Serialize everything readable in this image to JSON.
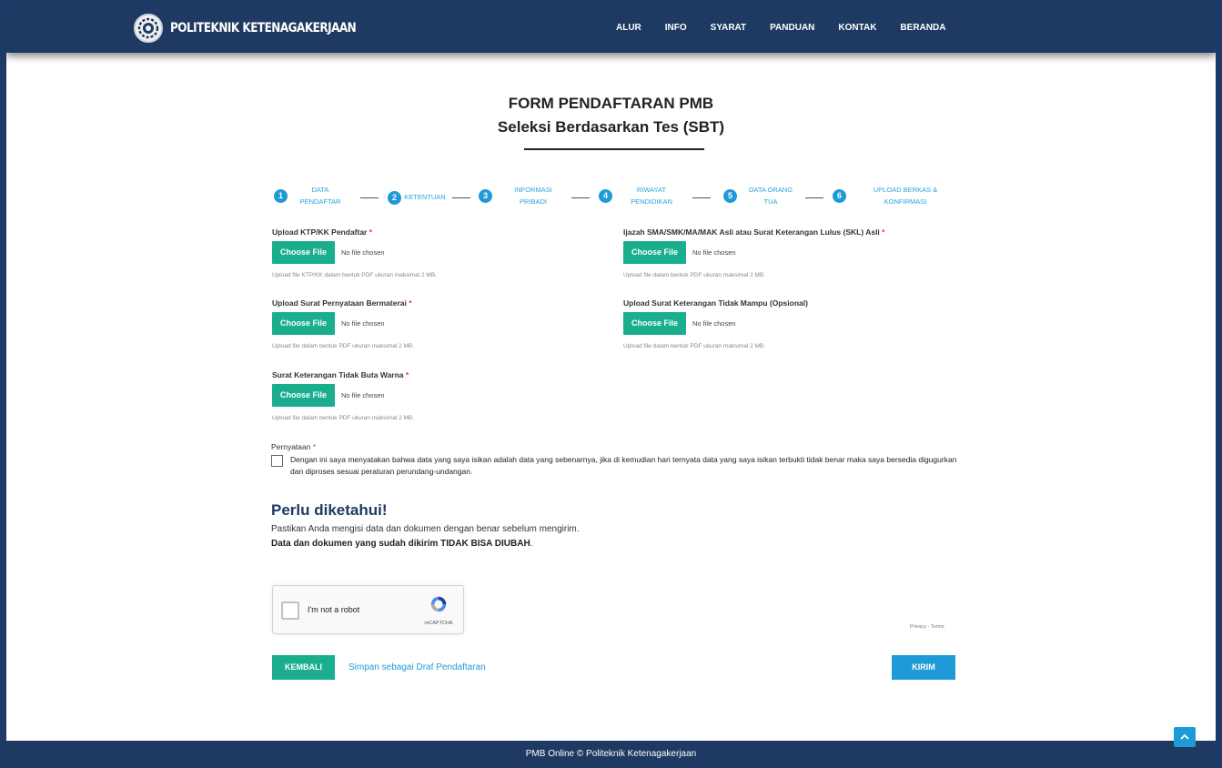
{
  "brand": {
    "name": "POLITEKNIK KETENAGAKERJAAN"
  },
  "nav": [
    "ALUR",
    "INFO",
    "SYARAT",
    "PANDUAN",
    "KONTAK",
    "BERANDA"
  ],
  "form": {
    "title": "FORM PENDAFTARAN PMB",
    "subtitle": "Seleksi Berdasarkan Tes (SBT)"
  },
  "steps": [
    {
      "num": "1",
      "line1": "DATA",
      "line2": "PENDAFTAR"
    },
    {
      "num": "2",
      "line1": "KETENTUAN",
      "line2": ""
    },
    {
      "num": "3",
      "line1": "INFORMASI",
      "line2": "PRIBADI"
    },
    {
      "num": "4",
      "line1": "RIWAYAT",
      "line2": "PENDIDIKAN"
    },
    {
      "num": "5",
      "line1": "DATA ORANG",
      "line2": "TUA"
    },
    {
      "num": "6",
      "line1": "UPLOAD BERKAS &",
      "line2": "KONFIRMASI"
    }
  ],
  "uploads": [
    {
      "label": "Upload KTP/KK Pendaftar",
      "required": "*",
      "button": "Choose File",
      "status": "No file chosen",
      "help": "Upload file KTP/KK dalam bentuk PDF ukuran maksimal 2 MB."
    },
    {
      "label": "Ijazah SMA/SMK/MA/MAK Asli atau Surat Keterangan Lulus (SKL) Asli",
      "required": "*",
      "button": "Choose File",
      "status": "No file chosen",
      "help": "Upload file dalam bentuk PDF ukuran maksimal 2 MB."
    },
    {
      "label": "Upload Surat Pernyataan Bermaterai",
      "required": "*",
      "button": "Choose File",
      "status": "No file chosen",
      "help": "Upload file dalam bentuk PDF ukuran maksimal 2 MB."
    },
    {
      "label": "Upload Surat Keterangan Tidak Mampu (Opsional)",
      "required": "",
      "button": "Choose File",
      "status": "No file chosen",
      "help": "Upload file dalam bentuk PDF ukuran maksimal 2 MB."
    },
    {
      "label": "Surat Keterangan Tidak Buta Warna",
      "required": "*",
      "button": "Choose File",
      "status": "No file chosen",
      "help": "Upload file dalam bentuk PDF ukuran maksimal 2 MB."
    }
  ],
  "pernyataan": {
    "label": "Pernyataan",
    "required": "*",
    "text": "Dengan ini saya menyatakan bahwa data yang saya isikan adalah data yang sebenarnya, jika di kemudian hari ternyata data yang saya isikan terbukti tidak benar maka saya bersedia digugurkan dan diproses sesuai peraturan perundang-undangan."
  },
  "notice": {
    "title": "Perlu diketahui!",
    "line1": "Pastikan Anda mengisi data dan dokumen dengan benar sebelum mengirim.",
    "line2_bold": "Data dan dokumen yang sudah dikirim TIDAK BISA DIUBAH",
    "line2_end": "."
  },
  "recaptcha": {
    "label": "I'm not a robot",
    "brand": "reCAPTCHA",
    "privacy": "Privacy - Terms"
  },
  "actions": {
    "back": "KEMBALI",
    "draft": "Simpan sebagai Draf Pendaftaran",
    "submit": "KIRIM"
  },
  "footer": {
    "text": "PMB Online © Politeknik Ketenagakerjaan"
  },
  "colors": {
    "navy": "#1e3a62",
    "teal": "#1aae8f",
    "blue": "#1e9bd7",
    "required": "#e23c3c"
  }
}
